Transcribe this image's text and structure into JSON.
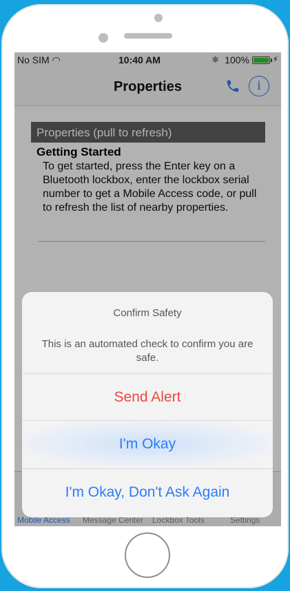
{
  "status_bar": {
    "carrier": "No SIM",
    "time": "10:40 AM",
    "battery": "100%"
  },
  "nav": {
    "title": "Properties"
  },
  "list": {
    "section_header": "Properties (pull to refresh)",
    "card_title": "Getting Started",
    "card_body": "To get started, press the Enter key on a Bluetooth lockbox, enter the lockbox serial number to get a Mobile Access code, or pull to refresh the list of nearby properties."
  },
  "tabs": [
    {
      "label": "Mobile Access",
      "active": true
    },
    {
      "label": "Message Center",
      "active": false
    },
    {
      "label": "Lockbox Tools",
      "active": false
    },
    {
      "label": "Settings",
      "active": false
    }
  ],
  "alert": {
    "title": "Confirm Safety",
    "message": "This is an automated check to confirm you are safe.",
    "buttons": {
      "send_alert": "Send Alert",
      "im_okay": "I'm Okay",
      "im_okay_dont_ask": "I'm Okay, Don't Ask Again"
    }
  },
  "colors": {
    "background": "#16a3df",
    "accent": "#2d7cf6",
    "destructive": "#f0463a"
  }
}
